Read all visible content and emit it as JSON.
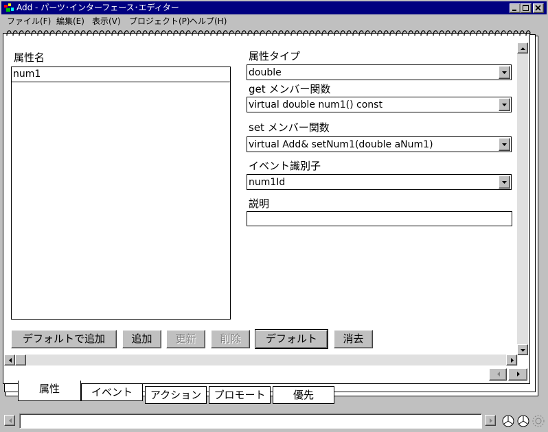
{
  "window": {
    "title": "Add - パーツ･インターフェース･エディター"
  },
  "menu": {
    "items": [
      "ファイル(F)",
      "編集(E)",
      "表示(V)",
      "プロジェクト(P)",
      "ヘルプ(H)"
    ]
  },
  "form": {
    "attr_name_label": "属性名",
    "attr_list": [
      "num1"
    ],
    "attr_type_label": "属性タイプ",
    "attr_type_value": "double",
    "get_label": "get メンバー関数",
    "get_value": "virtual double num1() const",
    "set_label": "set メンバー関数",
    "set_value": "virtual Add& setNum1(double aNum1)",
    "event_label": "イベント識別子",
    "event_value": "num1Id",
    "desc_label": "説明",
    "desc_value": ""
  },
  "buttons": {
    "add_default": "デフォルトで追加",
    "add": "追加",
    "update": "更新",
    "delete": "削除",
    "default": "デフォルト",
    "clear": "消去"
  },
  "tabs": [
    "属性",
    "イベント",
    "アクション",
    "プロモート",
    "優先"
  ],
  "colors": {
    "titlebar": "#000080",
    "face": "#c0c0c0",
    "disabled_text": "#808080"
  }
}
